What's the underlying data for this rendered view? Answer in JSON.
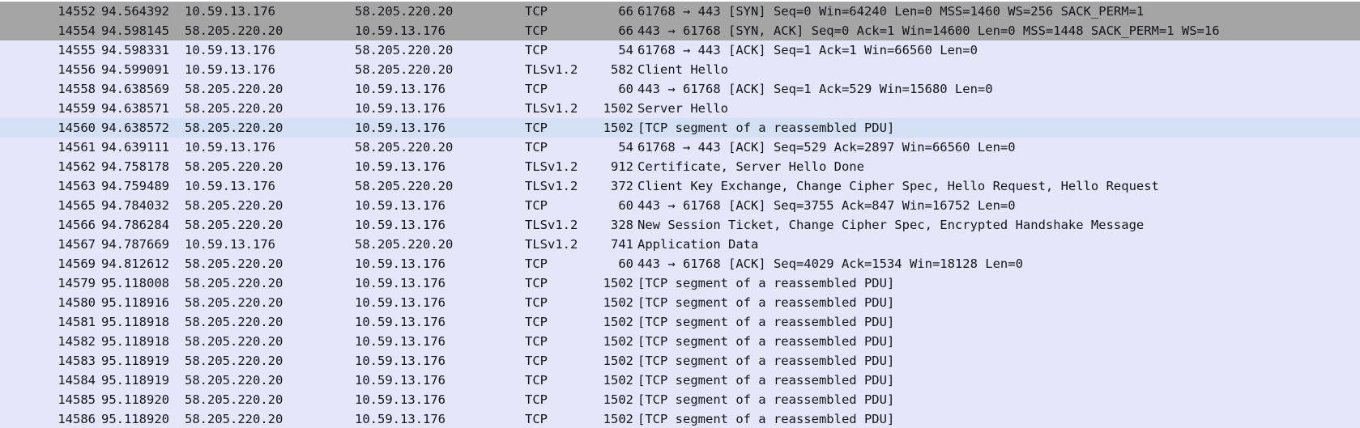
{
  "colors": {
    "syn_row_bg": "#a5a5a5",
    "tcp_row_bg": "#e6e6fa",
    "selected_row_bg": "#d4e1f5",
    "text": "#12141a"
  },
  "packets": [
    {
      "no": "14552",
      "time": "94.564392",
      "src": "10.59.13.176",
      "dst": "58.205.220.20",
      "proto": "TCP",
      "len": "66",
      "info": "61768 → 443 [SYN] Seq=0 Win=64240 Len=0 MSS=1460 WS=256 SACK_PERM=1",
      "style": "syn"
    },
    {
      "no": "14554",
      "time": "94.598145",
      "src": "58.205.220.20",
      "dst": "10.59.13.176",
      "proto": "TCP",
      "len": "66",
      "info": "443 → 61768 [SYN, ACK] Seq=0 Ack=1 Win=14600 Len=0 MSS=1448 SACK_PERM=1 WS=16",
      "style": "syn"
    },
    {
      "no": "14555",
      "time": "94.598331",
      "src": "10.59.13.176",
      "dst": "58.205.220.20",
      "proto": "TCP",
      "len": "54",
      "info": "61768 → 443 [ACK] Seq=1 Ack=1 Win=66560 Len=0",
      "style": "tcp"
    },
    {
      "no": "14556",
      "time": "94.599091",
      "src": "10.59.13.176",
      "dst": "58.205.220.20",
      "proto": "TLSv1.2",
      "len": "582",
      "info": "Client Hello",
      "style": "tcp"
    },
    {
      "no": "14558",
      "time": "94.638569",
      "src": "58.205.220.20",
      "dst": "10.59.13.176",
      "proto": "TCP",
      "len": "60",
      "info": "443 → 61768 [ACK] Seq=1 Ack=529 Win=15680 Len=0",
      "style": "tcp"
    },
    {
      "no": "14559",
      "time": "94.638571",
      "src": "58.205.220.20",
      "dst": "10.59.13.176",
      "proto": "TLSv1.2",
      "len": "1502",
      "info": "Server Hello",
      "style": "tcp"
    },
    {
      "no": "14560",
      "time": "94.638572",
      "src": "58.205.220.20",
      "dst": "10.59.13.176",
      "proto": "TCP",
      "len": "1502",
      "info": "[TCP segment of a reassembled PDU]",
      "style": "selected"
    },
    {
      "no": "14561",
      "time": "94.639111",
      "src": "10.59.13.176",
      "dst": "58.205.220.20",
      "proto": "TCP",
      "len": "54",
      "info": "61768 → 443 [ACK] Seq=529 Ack=2897 Win=66560 Len=0",
      "style": "tcp"
    },
    {
      "no": "14562",
      "time": "94.758178",
      "src": "58.205.220.20",
      "dst": "10.59.13.176",
      "proto": "TLSv1.2",
      "len": "912",
      "info": "Certificate, Server Hello Done",
      "style": "tcp"
    },
    {
      "no": "14563",
      "time": "94.759489",
      "src": "10.59.13.176",
      "dst": "58.205.220.20",
      "proto": "TLSv1.2",
      "len": "372",
      "info": "Client Key Exchange, Change Cipher Spec, Hello Request, Hello Request",
      "style": "tcp"
    },
    {
      "no": "14565",
      "time": "94.784032",
      "src": "58.205.220.20",
      "dst": "10.59.13.176",
      "proto": "TCP",
      "len": "60",
      "info": "443 → 61768 [ACK] Seq=3755 Ack=847 Win=16752 Len=0",
      "style": "tcp"
    },
    {
      "no": "14566",
      "time": "94.786284",
      "src": "58.205.220.20",
      "dst": "10.59.13.176",
      "proto": "TLSv1.2",
      "len": "328",
      "info": "New Session Ticket, Change Cipher Spec, Encrypted Handshake Message",
      "style": "tcp"
    },
    {
      "no": "14567",
      "time": "94.787669",
      "src": "10.59.13.176",
      "dst": "58.205.220.20",
      "proto": "TLSv1.2",
      "len": "741",
      "info": "Application Data",
      "style": "tcp"
    },
    {
      "no": "14569",
      "time": "94.812612",
      "src": "58.205.220.20",
      "dst": "10.59.13.176",
      "proto": "TCP",
      "len": "60",
      "info": "443 → 61768 [ACK] Seq=4029 Ack=1534 Win=18128 Len=0",
      "style": "tcp"
    },
    {
      "no": "14579",
      "time": "95.118008",
      "src": "58.205.220.20",
      "dst": "10.59.13.176",
      "proto": "TCP",
      "len": "1502",
      "info": "[TCP segment of a reassembled PDU]",
      "style": "tcp"
    },
    {
      "no": "14580",
      "time": "95.118916",
      "src": "58.205.220.20",
      "dst": "10.59.13.176",
      "proto": "TCP",
      "len": "1502",
      "info": "[TCP segment of a reassembled PDU]",
      "style": "tcp"
    },
    {
      "no": "14581",
      "time": "95.118918",
      "src": "58.205.220.20",
      "dst": "10.59.13.176",
      "proto": "TCP",
      "len": "1502",
      "info": "[TCP segment of a reassembled PDU]",
      "style": "tcp"
    },
    {
      "no": "14582",
      "time": "95.118918",
      "src": "58.205.220.20",
      "dst": "10.59.13.176",
      "proto": "TCP",
      "len": "1502",
      "info": "[TCP segment of a reassembled PDU]",
      "style": "tcp"
    },
    {
      "no": "14583",
      "time": "95.118919",
      "src": "58.205.220.20",
      "dst": "10.59.13.176",
      "proto": "TCP",
      "len": "1502",
      "info": "[TCP segment of a reassembled PDU]",
      "style": "tcp"
    },
    {
      "no": "14584",
      "time": "95.118919",
      "src": "58.205.220.20",
      "dst": "10.59.13.176",
      "proto": "TCP",
      "len": "1502",
      "info": "[TCP segment of a reassembled PDU]",
      "style": "tcp"
    },
    {
      "no": "14585",
      "time": "95.118920",
      "src": "58.205.220.20",
      "dst": "10.59.13.176",
      "proto": "TCP",
      "len": "1502",
      "info": "[TCP segment of a reassembled PDU]",
      "style": "tcp"
    },
    {
      "no": "14586",
      "time": "95.118920",
      "src": "58.205.220.20",
      "dst": "10.59.13.176",
      "proto": "TCP",
      "len": "1502",
      "info": "[TCP segment of a reassembled PDU]",
      "style": "tcp"
    }
  ]
}
